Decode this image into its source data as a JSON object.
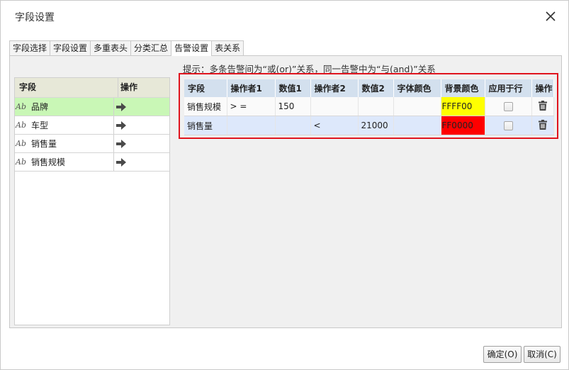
{
  "dialog": {
    "title": "字段设置"
  },
  "tabs": [
    {
      "label": "字段选择"
    },
    {
      "label": "字段设置"
    },
    {
      "label": "多重表头"
    },
    {
      "label": "分类汇总"
    },
    {
      "label": "告警设置",
      "active": true
    },
    {
      "label": "表关系"
    }
  ],
  "field_list": {
    "headers": {
      "field": "字段",
      "action": "操作"
    },
    "items": [
      {
        "type_icon": "Ab",
        "label": "品牌",
        "selected": true
      },
      {
        "type_icon": "Ab",
        "label": "车型"
      },
      {
        "type_icon": "Ab",
        "label": "销售量"
      },
      {
        "type_icon": "Ab",
        "label": "销售规模"
      }
    ]
  },
  "hint": "提示：多条告警间为“或(or)”关系，同一告警中为“与(and)”关系",
  "alert_table": {
    "headers": [
      "字段",
      "操作者1",
      "数值1",
      "操作者2",
      "数值2",
      "字体颜色",
      "背景颜色",
      "应用于行",
      "操作"
    ],
    "rows": [
      {
        "field": "销售规模",
        "op1": "> =",
        "val1": "150",
        "op2": "",
        "val2": "",
        "font_color": "",
        "bg_color": "FFFF00",
        "bg_color_hex": "#ffff00",
        "apply_row": false
      },
      {
        "field": "销售量",
        "op1": "",
        "val1": "",
        "op2": "<",
        "val2": "21000",
        "font_color": "",
        "bg_color": "FF0000",
        "bg_color_hex": "#ff0000",
        "apply_row": false
      }
    ]
  },
  "buttons": {
    "ok": "确定(O)",
    "cancel": "取消(C)"
  },
  "colors": {
    "highlight_border": "#e0141e",
    "selected_row": "#c9f7b6",
    "table_header": "#d3e0ee"
  },
  "icons": {
    "close": "close-icon",
    "move": "arrow-right-icon",
    "delete": "trash-icon",
    "field_type": "text-type-icon"
  }
}
